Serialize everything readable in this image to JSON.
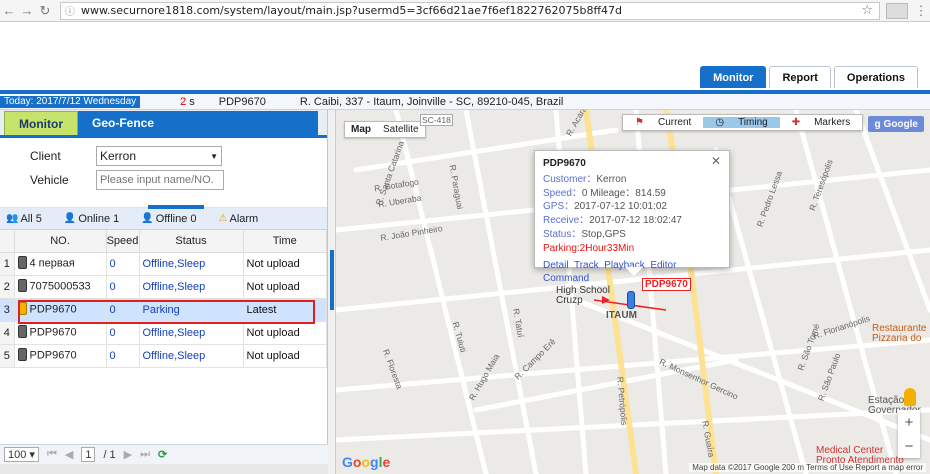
{
  "browser": {
    "url": "www.securnore1818.com/system/layout/main.jsp?usermd5=3cf66d21ae7f6ef1822762075b8ff47d"
  },
  "topnav": {
    "items": [
      "Monitor",
      "Report",
      "Operations"
    ]
  },
  "statusbar": {
    "today": "Today: 2017/7/12 Wednesday",
    "seconds": "2",
    "seconds_unit": "s",
    "vehicle": "PDP9670",
    "address": "R. Caibi, 337 - Itaum, Joinville - SC, 89210-045, Brazil"
  },
  "left": {
    "tabs": [
      "Monitor",
      "Geo-Fence"
    ],
    "client_label": "Client",
    "client_value": "Kerron",
    "vehicle_label": "Vehicle",
    "vehicle_placeholder": "Please input name/NO.",
    "filters": {
      "all": "All 5",
      "online": "Online 1",
      "offline": "Offline 0",
      "alarm": "Alarm"
    },
    "columns": [
      "NO.",
      "Speed",
      "Status",
      "Time"
    ],
    "rows": [
      {
        "idx": "1",
        "no": "4 первая",
        "speed": "0",
        "status": "Offline,Sleep",
        "time": "Not upload"
      },
      {
        "idx": "2",
        "no": "7075000533",
        "speed": "0",
        "status": "Offline,Sleep",
        "time": "Not upload"
      },
      {
        "idx": "3",
        "no": "PDP9670",
        "speed": "0",
        "status": "Parking",
        "time": "Latest"
      },
      {
        "idx": "4",
        "no": "PDP9670",
        "speed": "0",
        "status": "Offline,Sleep",
        "time": "Not upload"
      },
      {
        "idx": "5",
        "no": "PDP9670",
        "speed": "0",
        "status": "Offline,Sleep",
        "time": "Not upload"
      }
    ],
    "pager": {
      "page_size": "100",
      "page": "1",
      "total": "/ 1"
    }
  },
  "map": {
    "maptypes": [
      "Map",
      "Satellite"
    ],
    "tools": [
      "Current",
      "Timing",
      "Markers"
    ],
    "google": "Google",
    "popup": {
      "title": "PDP9670",
      "customer_k": "Customer：",
      "customer_v": "Kerron",
      "speed_k": "Speed：",
      "speed_v": "0 Mileage：814.59",
      "gps_k": "GPS：",
      "gps_v": "2017-07-12 10:01:02",
      "receive_k": "Receive：",
      "receive_v": "2017-07-12 18:02:47",
      "status_k": "Status：",
      "status_v": "Stop,GPS",
      "parking": "Parking:2Hour33Min",
      "links": [
        "Detail",
        "Track",
        "Playback",
        "Editor",
        "Command"
      ]
    },
    "plate": "PDP9670",
    "pois": {
      "school": "High School Cruzp",
      "itaum": "ITAUM",
      "restaurant": "Restaurante Pizzaria do",
      "estacao": "Estação Governador",
      "medical": "Medical Center Pronto Atendimento"
    },
    "streets": [
      "R. Botafogo",
      "R. Uberaba",
      "R. João Pinheiro",
      "R. Santa Catarina",
      "R. Paraguai",
      "R. Tuiuti",
      "R. Tatuí",
      "R. Campo Erê",
      "R. Floresta",
      "R. Monsenhor Gercino",
      "R. Florianópolis",
      "R. São Tomé",
      "R. São Paulo",
      "R. Acará",
      "R. Pedro Lessa",
      "R. Teresópolis",
      "SC-418",
      "R. Petrópolis",
      "R. Hugo Maia",
      "R. Guaíra"
    ],
    "attribution": "Map data ©2017 Google   200 m   Terms of Use   Report a map error"
  }
}
